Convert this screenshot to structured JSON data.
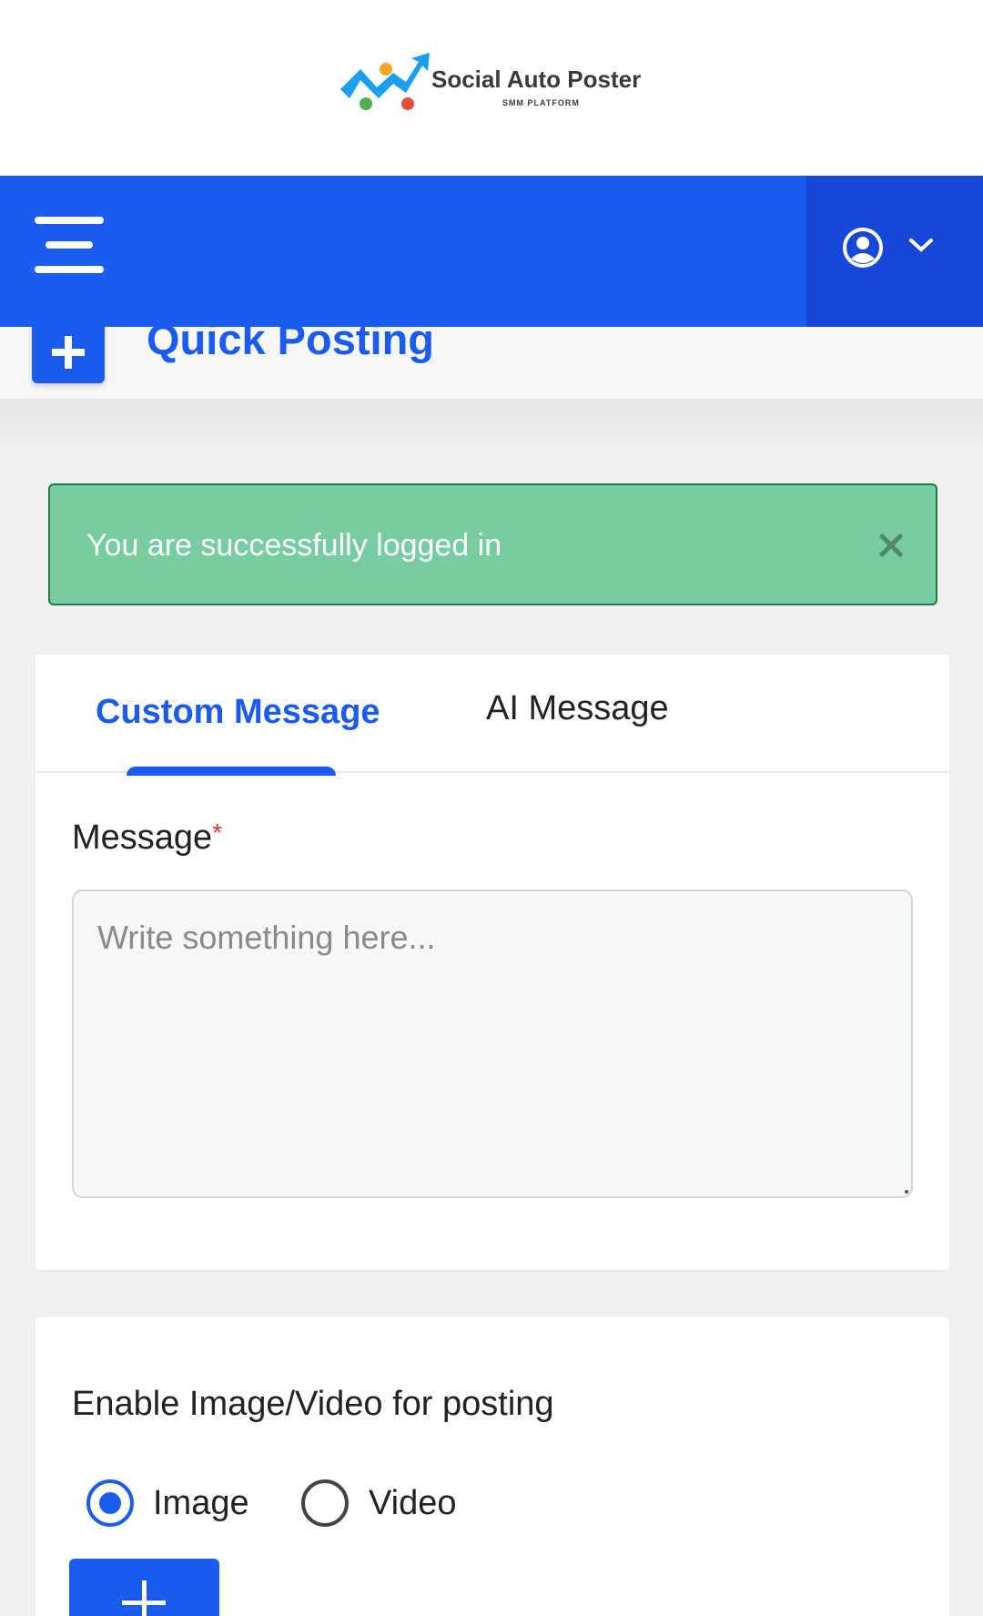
{
  "logo": {
    "title": "Social Auto Poster",
    "subtitle": "SMM PLATFORM",
    "colors": [
      "#1a9ef0",
      "#f5a623",
      "#e84c3d",
      "#4caf50"
    ]
  },
  "navbar": {
    "menu_icon": "hamburger-menu-icon",
    "user_icon": "user-circle-icon",
    "dropdown_icon": "chevron-down-icon"
  },
  "page": {
    "title": "Quick Posting",
    "title_icon": "plus-icon"
  },
  "alert": {
    "text": "You are successfully logged in",
    "close_icon": "close-icon"
  },
  "tabs": [
    {
      "label": "Custom Message",
      "active": true
    },
    {
      "label": "AI Message",
      "active": false
    }
  ],
  "message": {
    "label": "Message",
    "required_mark": "*",
    "placeholder": "Write something here..."
  },
  "media": {
    "label": "Enable Image/Video for posting",
    "options": [
      {
        "label": "Image",
        "selected": true
      },
      {
        "label": "Video",
        "selected": false
      }
    ],
    "add_icon": "plus-icon"
  },
  "colors": {
    "brand_blue": "#1a5cf0",
    "alert_green": "#77cca0",
    "alert_border": "#1e7b43"
  }
}
